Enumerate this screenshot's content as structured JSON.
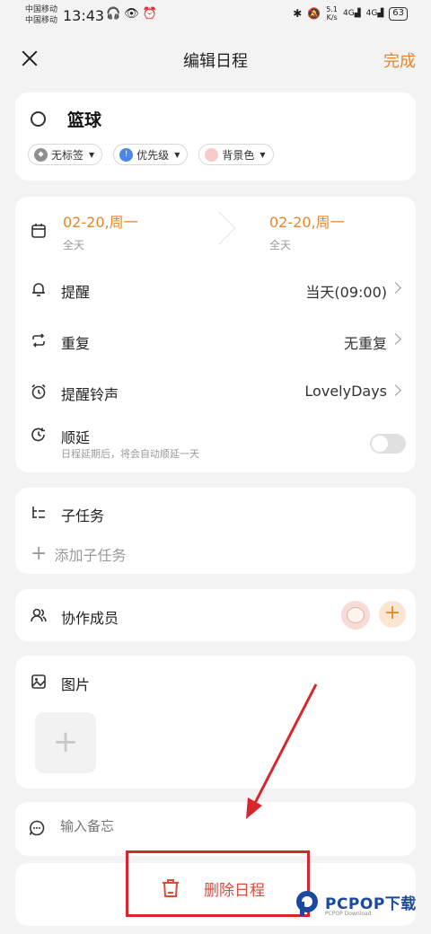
{
  "status": {
    "carrier1": "中国移动",
    "carrier2": "中国移动",
    "time": "13:43",
    "speed_value": "5.1",
    "speed_unit": "K/s",
    "battery": "63",
    "sig1": "4G",
    "sig2": "4G"
  },
  "header": {
    "title": "编辑日程",
    "done": "完成"
  },
  "task": {
    "name": "篮球",
    "chips": [
      {
        "label": "无标签",
        "color": "#8f8f8f"
      },
      {
        "label": "优先级",
        "color": "#4c86e8"
      },
      {
        "label": "背景色",
        "color": "#f9caca"
      }
    ]
  },
  "schedule": {
    "start_date": "02-20,周一",
    "start_sub": "全天",
    "end_date": "02-20,周一",
    "end_sub": "全天",
    "reminder_label": "提醒",
    "reminder_value": "当天(09:00)",
    "repeat_label": "重复",
    "repeat_value": "无重复",
    "ringtone_label": "提醒铃声",
    "ringtone_value": "LovelyDays",
    "postpone_label": "顺延",
    "postpone_desc": "日程延期后，将会自动顺延一天"
  },
  "subtask": {
    "title": "子任务",
    "add": "添加子任务"
  },
  "collab": {
    "title": "协作成员"
  },
  "picture": {
    "title": "图片"
  },
  "memo": {
    "placeholder": "输入备忘"
  },
  "delete": {
    "label": "删除日程"
  },
  "watermark": {
    "brand": "PCPOP下载",
    "sub": "PCPOP Download"
  },
  "colors": {
    "accent": "#e8862a",
    "danger": "#e04a3a",
    "annotation": "#d8262e"
  }
}
